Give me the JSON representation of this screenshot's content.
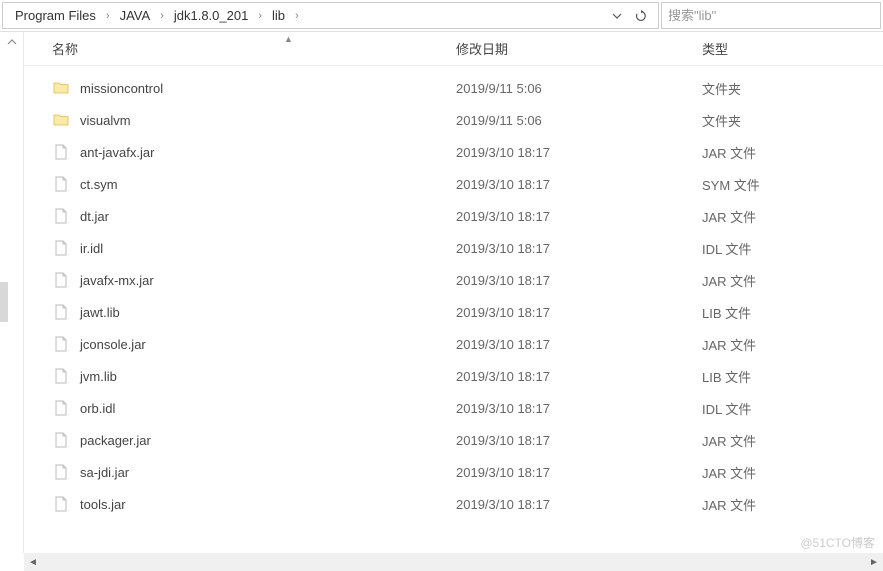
{
  "breadcrumb": {
    "items": [
      "Program Files",
      "JAVA",
      "jdk1.8.0_201",
      "lib"
    ]
  },
  "search": {
    "placeholder": "搜索\"lib\""
  },
  "columns": {
    "name": "名称",
    "date": "修改日期",
    "type": "类型"
  },
  "files": [
    {
      "icon": "folder",
      "name": "missioncontrol",
      "date": "2019/9/11 5:06",
      "type": "文件夹"
    },
    {
      "icon": "folder",
      "name": "visualvm",
      "date": "2019/9/11 5:06",
      "type": "文件夹"
    },
    {
      "icon": "file",
      "name": "ant-javafx.jar",
      "date": "2019/3/10 18:17",
      "type": "JAR 文件"
    },
    {
      "icon": "file",
      "name": "ct.sym",
      "date": "2019/3/10 18:17",
      "type": "SYM 文件"
    },
    {
      "icon": "file",
      "name": "dt.jar",
      "date": "2019/3/10 18:17",
      "type": "JAR 文件"
    },
    {
      "icon": "file",
      "name": "ir.idl",
      "date": "2019/3/10 18:17",
      "type": "IDL 文件"
    },
    {
      "icon": "file",
      "name": "javafx-mx.jar",
      "date": "2019/3/10 18:17",
      "type": "JAR 文件"
    },
    {
      "icon": "file",
      "name": "jawt.lib",
      "date": "2019/3/10 18:17",
      "type": "LIB 文件"
    },
    {
      "icon": "file",
      "name": "jconsole.jar",
      "date": "2019/3/10 18:17",
      "type": "JAR 文件"
    },
    {
      "icon": "file",
      "name": "jvm.lib",
      "date": "2019/3/10 18:17",
      "type": "LIB 文件"
    },
    {
      "icon": "file",
      "name": "orb.idl",
      "date": "2019/3/10 18:17",
      "type": "IDL 文件"
    },
    {
      "icon": "file",
      "name": "packager.jar",
      "date": "2019/3/10 18:17",
      "type": "JAR 文件"
    },
    {
      "icon": "file",
      "name": "sa-jdi.jar",
      "date": "2019/3/10 18:17",
      "type": "JAR 文件"
    },
    {
      "icon": "file",
      "name": "tools.jar",
      "date": "2019/3/10 18:17",
      "type": "JAR 文件"
    }
  ],
  "watermark": "@51CTO博客"
}
